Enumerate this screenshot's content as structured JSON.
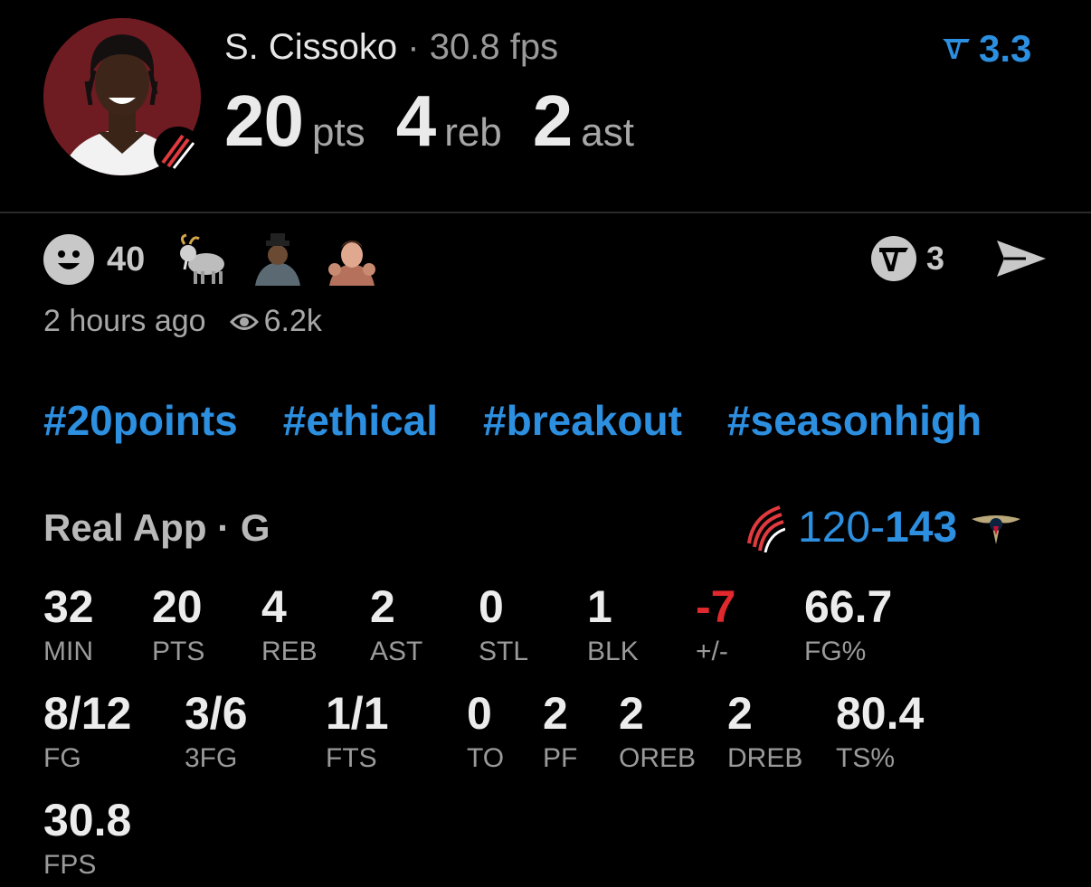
{
  "post": {
    "player_name": "S. Cissoko",
    "separator": "·",
    "fps_text": "30.8 fps",
    "rating": "3.3",
    "headline": [
      {
        "value": "20",
        "unit": "pts"
      },
      {
        "value": "4",
        "unit": "reb"
      },
      {
        "value": "2",
        "unit": "ast"
      }
    ]
  },
  "reactions": {
    "count": "40",
    "emojis": [
      "goat-emoji",
      "person-sticker",
      "person-sticker-2"
    ],
    "repost_count": "3"
  },
  "meta": {
    "time_ago": "2 hours ago",
    "views": "6.2k"
  },
  "hashtags": [
    "#20points",
    "#ethical",
    "#breakout",
    "#seasonhigh"
  ],
  "game": {
    "source": "Real App",
    "separator": "·",
    "position": "G",
    "score_home": "120",
    "score_dash": "-",
    "score_away": "143"
  },
  "stats_row1": [
    {
      "value": "32",
      "label": "MIN"
    },
    {
      "value": "20",
      "label": "PTS"
    },
    {
      "value": "4",
      "label": "REB"
    },
    {
      "value": "2",
      "label": "AST"
    },
    {
      "value": "0",
      "label": "STL"
    },
    {
      "value": "1",
      "label": "BLK"
    },
    {
      "value": "-7",
      "label": "+/-"
    },
    {
      "value": "66.7",
      "label": "FG%"
    }
  ],
  "stats_row2": [
    {
      "value": "8/12",
      "label": "FG"
    },
    {
      "value": "3/6",
      "label": "3FG"
    },
    {
      "value": "1/1",
      "label": "FTS"
    },
    {
      "value": "0",
      "label": "TO"
    },
    {
      "value": "2",
      "label": "PF"
    },
    {
      "value": "2",
      "label": "OREB"
    },
    {
      "value": "2",
      "label": "DREB"
    },
    {
      "value": "80.4",
      "label": "TS%"
    }
  ],
  "stats_row3": [
    {
      "value": "30.8",
      "label": "FPS"
    }
  ],
  "colors": {
    "accent": "#2d8fe0",
    "negative": "#e0282d",
    "team_red": "#e03a3e"
  }
}
